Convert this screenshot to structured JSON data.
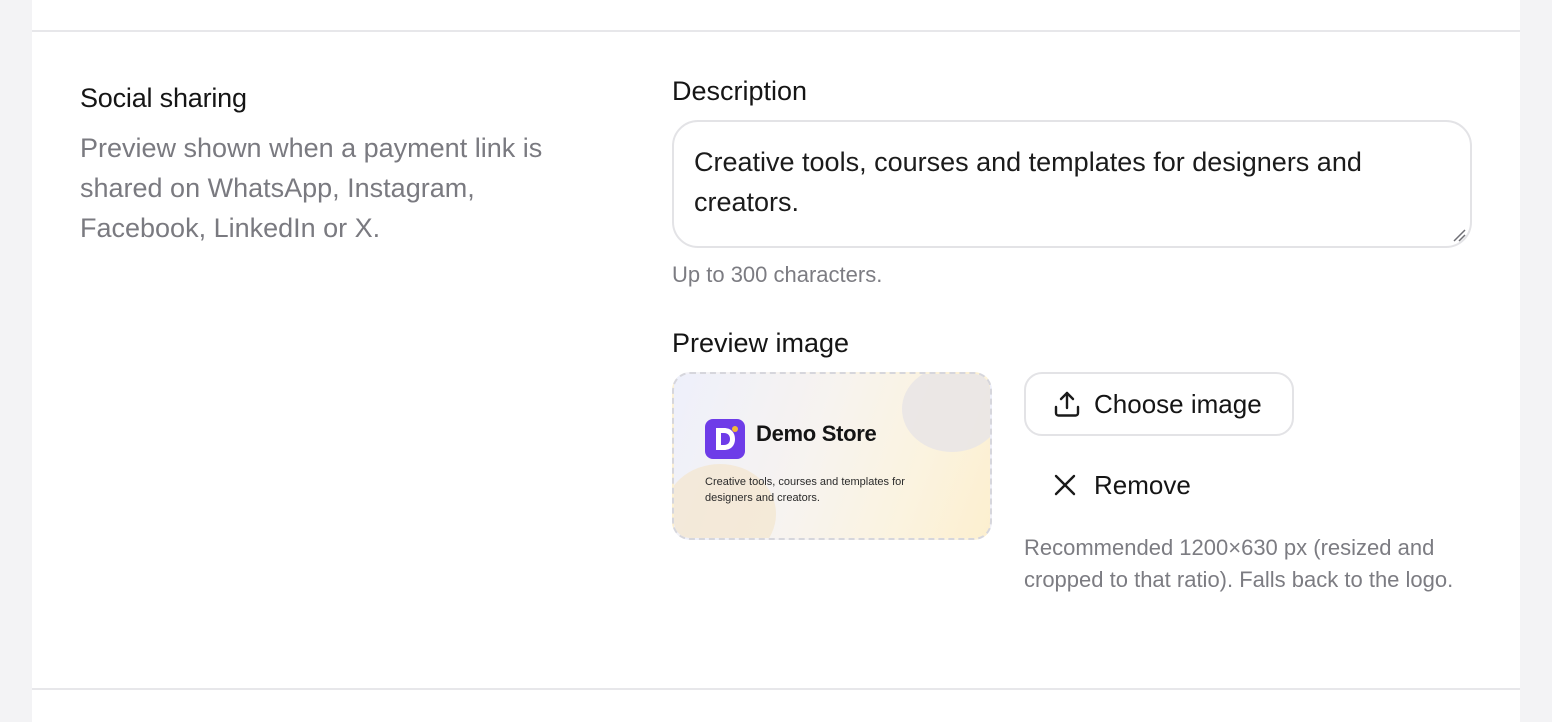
{
  "section": {
    "title": "Social sharing",
    "description": "Preview shown when a payment link is shared on WhatsApp, Instagram, Facebook, LinkedIn or X."
  },
  "description_field": {
    "label": "Description",
    "value": "Creative tools, courses and templates for designers and creators.",
    "helper": "Up to 300 characters."
  },
  "preview_image": {
    "label": "Preview image",
    "store_name": "Demo Store",
    "text": "Creative tools, courses and templates for designers and creators.",
    "logo_color": "#6e3ce8"
  },
  "actions": {
    "choose_label": "Choose image",
    "choose_icon": "upload-icon",
    "remove_label": "Remove",
    "remove_icon": "close-icon"
  },
  "recommendation": "Recommended 1200×630 px (resized and cropped to that ratio). Falls back to the logo."
}
